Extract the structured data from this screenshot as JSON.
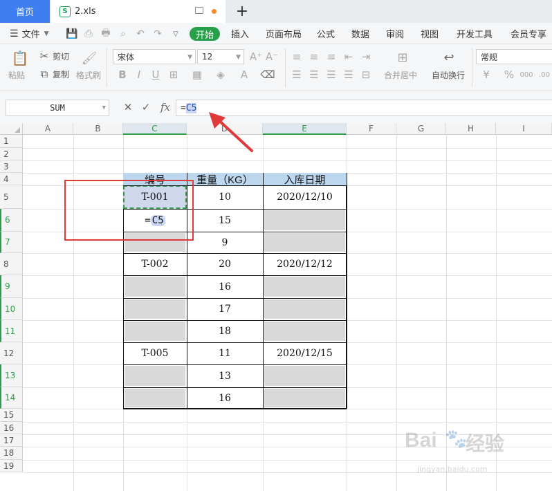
{
  "tabs": {
    "home": "首页",
    "file": "2.xls"
  },
  "menu": {
    "file": "文件",
    "items": [
      "开始",
      "插入",
      "页面布局",
      "公式",
      "数据",
      "审阅",
      "视图",
      "开发工具",
      "会员专享"
    ]
  },
  "ribbon": {
    "paste": "粘贴",
    "cut": "剪切",
    "copy": "复制",
    "format_painter": "格式刷",
    "font_name": "宋体",
    "font_size": "12",
    "merge_center": "合并居中",
    "wrap_text": "自动换行",
    "number_format": "常规"
  },
  "formula_bar": {
    "name_box": "SUM",
    "prefix": "=",
    "ref": "C5"
  },
  "columns": [
    "A",
    "B",
    "C",
    "D",
    "E",
    "F",
    "G",
    "H",
    "I"
  ],
  "rows": [
    "1",
    "2",
    "3",
    "4",
    "5",
    "6",
    "7",
    "8",
    "9",
    "10",
    "11",
    "12",
    "13",
    "14",
    "15",
    "16",
    "17",
    "18",
    "19"
  ],
  "table": {
    "headers": [
      "编号",
      "重量（KG）",
      "入库日期"
    ],
    "rows": [
      [
        "T-001",
        "10",
        "2020/12/10"
      ],
      [
        "=C5",
        "15",
        ""
      ],
      [
        "",
        "9",
        ""
      ],
      [
        "T-002",
        "20",
        "2020/12/12"
      ],
      [
        "",
        "16",
        ""
      ],
      [
        "",
        "17",
        ""
      ],
      [
        "",
        "18",
        ""
      ],
      [
        "T-005",
        "11",
        "2020/12/15"
      ],
      [
        "",
        "13",
        ""
      ],
      [
        "",
        "16",
        ""
      ]
    ]
  },
  "editing_cell": {
    "prefix": "=",
    "ref": "C5"
  },
  "watermark": {
    "brand": "Bai",
    "suffix": "经验",
    "url": "jingyan.baidu.com"
  },
  "colors": {
    "accent": "#27a04a",
    "home_tab": "#3e7ef0",
    "header_fill": "#bdd7ee",
    "empty_fill": "#d9d9d9",
    "annotation": "#e0393a"
  }
}
